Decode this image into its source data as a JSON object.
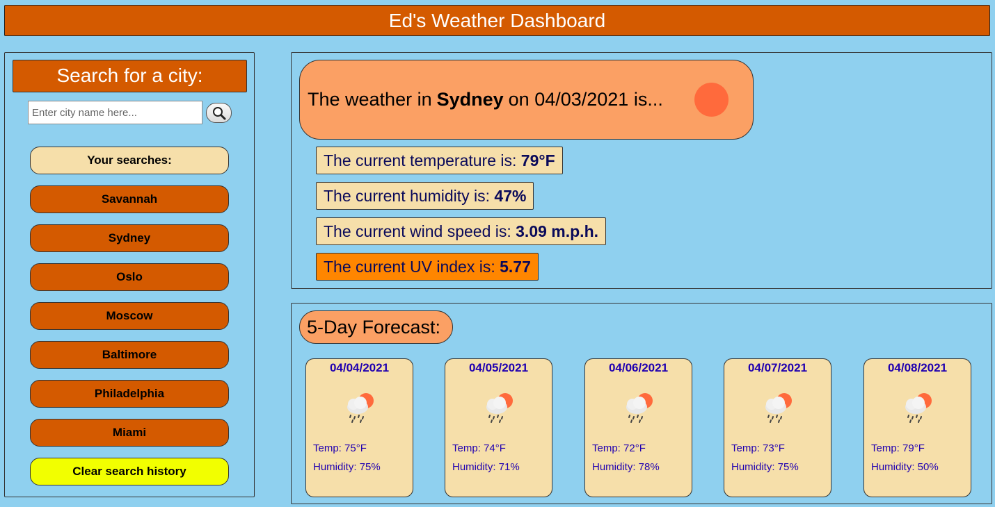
{
  "header": {
    "title": "Ed's Weather Dashboard"
  },
  "sidebar": {
    "title": "Search for a city:",
    "search_placeholder": "Enter city name here...",
    "searches_label": "Your searches:",
    "cities": [
      "Savannah",
      "Sydney",
      "Oslo",
      "Moscow",
      "Baltimore",
      "Philadelphia",
      "Miami"
    ],
    "clear_label": "Clear search history"
  },
  "current": {
    "prefix": "The weather in",
    "city": "Sydney",
    "date_text": "on 04/03/2021 is...",
    "temp_label": "The current temperature is:",
    "temp_value": "79°F",
    "humidity_label": "The current humidity is:",
    "humidity_value": "47%",
    "wind_label": "The current wind speed is:",
    "wind_value": "3.09 m.p.h.",
    "uv_label": "The current UV index is:",
    "uv_value": "5.77"
  },
  "forecast": {
    "title": "5-Day Forecast:",
    "days": [
      {
        "date": "04/04/2021",
        "temp": "Temp: 75°F",
        "humidity": "Humidity: 75%"
      },
      {
        "date": "04/05/2021",
        "temp": "Temp: 74°F",
        "humidity": "Humidity: 71%"
      },
      {
        "date": "04/06/2021",
        "temp": "Temp: 72°F",
        "humidity": "Humidity: 78%"
      },
      {
        "date": "04/07/2021",
        "temp": "Temp: 73°F",
        "humidity": "Humidity: 75%"
      },
      {
        "date": "04/08/2021",
        "temp": "Temp: 79°F",
        "humidity": "Humidity: 50%"
      }
    ],
    "icon": "sun-cloud-rain-icon"
  },
  "colors": {
    "background": "#8fd0ef",
    "accent": "#d45a00",
    "light": "#f6dfaa",
    "salmon": "#fba064",
    "uv": "#ff8600",
    "clear_button": "#f2ff00"
  }
}
